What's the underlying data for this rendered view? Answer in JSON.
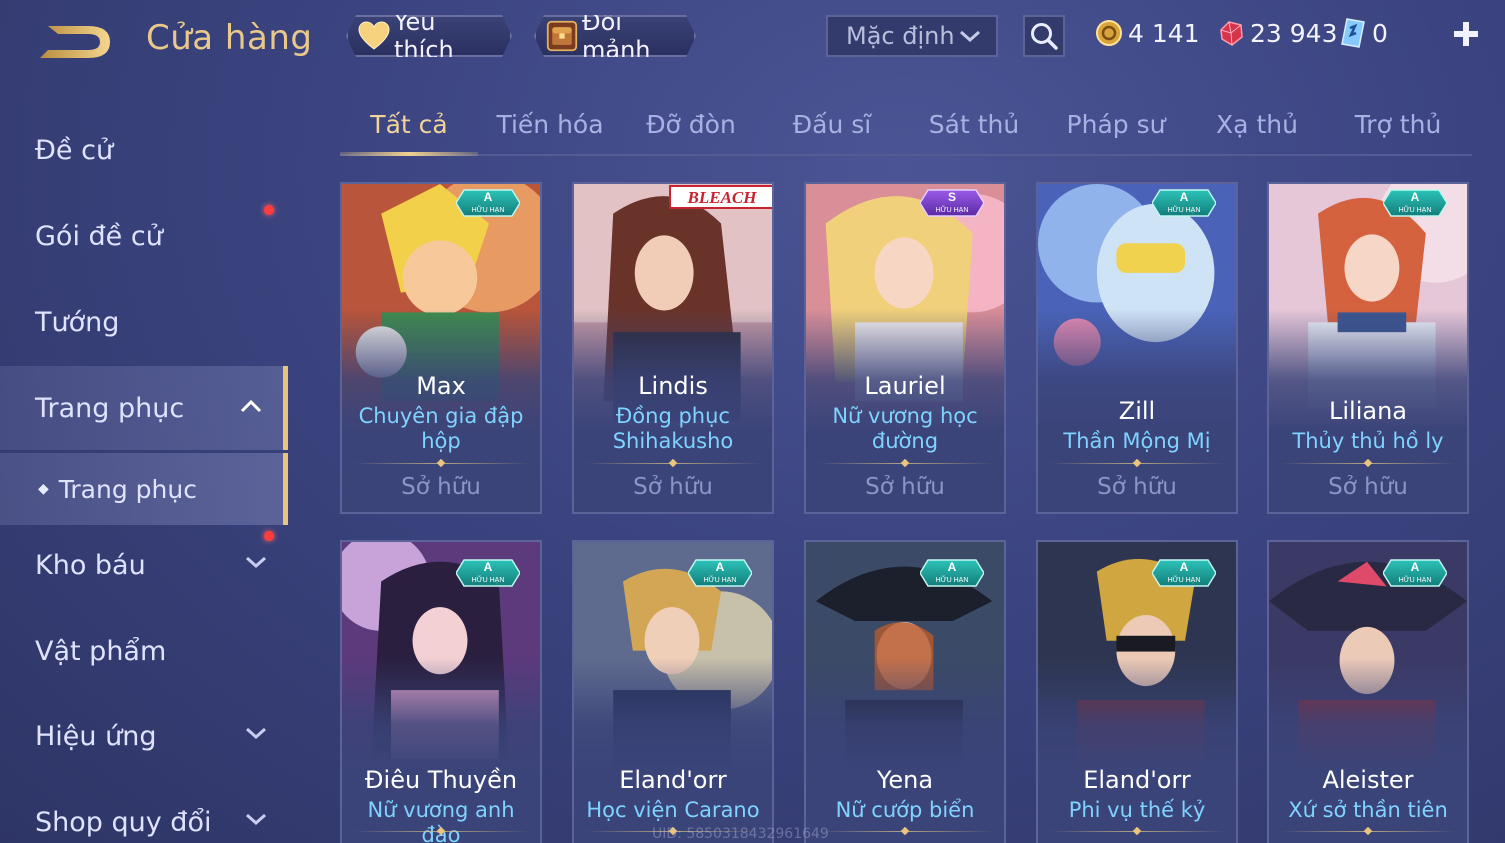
{
  "header": {
    "title": "Cửa hàng",
    "favorite_label": "Yêu thích",
    "exchange_label": "Đổi mảnh",
    "sort_value": "Mặc định",
    "currencies": {
      "gold": "4 141",
      "gem": "23 943",
      "voucher": "0"
    }
  },
  "sidebar": {
    "items": [
      {
        "label": "Đề cử"
      },
      {
        "label": "Gói đề cử"
      },
      {
        "label": "Tướng"
      },
      {
        "label": "Trang phục"
      },
      {
        "label": "Trang phục"
      },
      {
        "label": "Kho báu"
      },
      {
        "label": "Vật phẩm"
      },
      {
        "label": "Hiệu ứng"
      },
      {
        "label": "Shop quy đổi"
      }
    ]
  },
  "tabs": [
    "Tất cả",
    "Tiến hóa",
    "Đỡ đòn",
    "Đấu sĩ",
    "Sát thủ",
    "Pháp sư",
    "Xạ thủ",
    "Trợ thủ"
  ],
  "cards": [
    {
      "hero": "Max",
      "skin1": "Chuyên gia đập",
      "skin2": "hộp",
      "status": "Sở hữu",
      "grade": "A",
      "tag": "HỮU HẠN"
    },
    {
      "hero": "Lindis",
      "skin1": "Đồng phục",
      "skin2": "Shihakusho",
      "status": "Sở hữu",
      "logo": "BLEACH"
    },
    {
      "hero": "Lauriel",
      "skin1": "Nữ vương học",
      "skin2": "đường",
      "status": "Sở hữu",
      "grade": "S",
      "tag": "HỮU HẠN"
    },
    {
      "hero": "Zill",
      "skin1": "Thần Mộng Mị",
      "status": "Sở hữu",
      "grade": "A",
      "tag": "HỮU HẠN"
    },
    {
      "hero": "Liliana",
      "skin1": "Thủy thủ hồ ly",
      "status": "Sở hữu",
      "grade": "A",
      "tag": "HỮU HẠN"
    },
    {
      "hero": "Điêu Thuyền",
      "skin1": "Nữ vương anh đào",
      "grade": "A",
      "tag": "HỮU HẠN"
    },
    {
      "hero": "Eland'orr",
      "skin1": "Học viện Carano",
      "grade": "A",
      "tag": "HỮU HẠN"
    },
    {
      "hero": "Yena",
      "skin1": "Nữ cướp biển",
      "grade": "A",
      "tag": "HỮU HẠN"
    },
    {
      "hero": "Eland'orr",
      "skin1": "Phi vụ thế kỷ",
      "grade": "A",
      "tag": "HỮU HẠN"
    },
    {
      "hero": "Aleister",
      "skin1": "Xứ sở thần tiên",
      "grade": "A",
      "tag": "HỮU HẠN"
    }
  ],
  "watermark": "UID: 5850318432961649",
  "colors": {
    "accent_gold": "#e9c98a",
    "skin_name_blue": "#7fd3ff",
    "badge_teal": "#1fa7a0",
    "badge_purple": "#7b3fc9",
    "notify_red": "#ff3b3b"
  }
}
